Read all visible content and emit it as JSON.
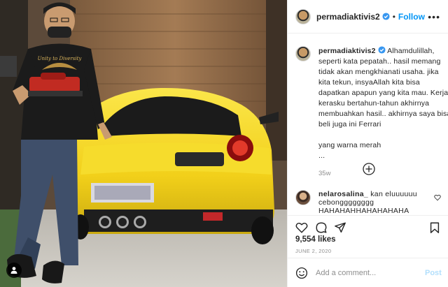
{
  "post": {
    "username": "permadiaktivis2",
    "follow_label": "Follow",
    "more_label": "•••",
    "dot_sep": "•"
  },
  "caption": {
    "username": "permadiaktivis2",
    "first_line_after_name": " Alhamdulillah,",
    "lines": [
      "seperti kata pepatah.. hasil memang",
      "tidak akan mengkhianati usaha. jika",
      "kita tekun, insyaAllah kita bisa",
      "dapatkan apapun yang kita mau. Kerja",
      "kerasku bertahun-tahun akhirnya",
      "membuahkan hasil.. akhirnya saya bisa",
      "beli juga ini Ferrari",
      " ",
      "yang warna merah",
      "..."
    ],
    "time": "35w"
  },
  "comment": {
    "username": "nelarosalina_",
    "text_first": " kan eluuuuuu",
    "text_lines": [
      "cebongggggggg",
      "HAHAHAHHAHAHAHAHA"
    ]
  },
  "stats": {
    "likes": "9,554 likes",
    "date": "JUNE 2, 2020"
  },
  "add_comment": {
    "placeholder": "Add a comment...",
    "post_label": "Post"
  },
  "photo": {
    "shirt_text": "Unity to Diversity",
    "car_color": "#f2d31b",
    "plate_text": ""
  },
  "icons": {
    "verified": "verified-badge-icon",
    "load_more": "plus-circle-icon",
    "like": "heart-icon",
    "comment": "comment-bubble-icon",
    "share": "paper-plane-icon",
    "save": "bookmark-icon",
    "emoji": "smiley-icon",
    "user_tag": "person-icon"
  },
  "colors": {
    "accent_blue": "#0095f6",
    "verified_blue": "#3897f0",
    "post_disabled": "#b2dffc",
    "meta_grey": "#8e8e8e"
  }
}
